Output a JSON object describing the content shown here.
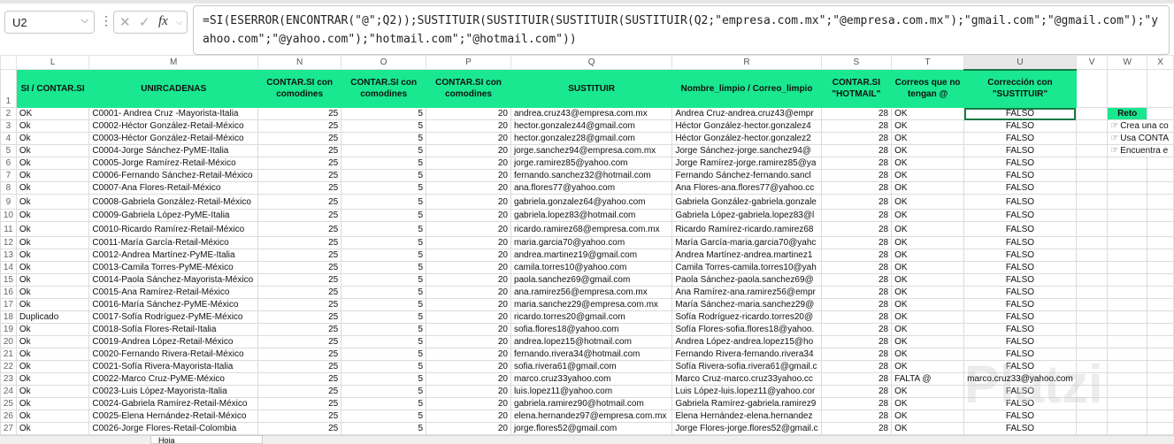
{
  "name_box": "U2",
  "formula": "=SI(ESERROR(ENCONTRAR(\"@\";Q2));SUSTITUIR(SUSTITUIR(SUSTITUIR(SUSTITUIR(Q2;\"empresa.com.mx\";\"@empresa.com.mx\");\"gmail.com\";\"@gmail.com\");\"yahoo.com\";\"@yahoo.com\");\"hotmail.com\";\"@hotmail.com\"))",
  "fx_label": "fx",
  "columns": [
    "L",
    "M",
    "N",
    "O",
    "P",
    "Q",
    "R",
    "S",
    "T",
    "U",
    "V",
    "W",
    "X"
  ],
  "headers": [
    "SI / CONTAR.SI",
    "UNIRCADENAS",
    "CONTAR.SI con comodines",
    "CONTAR.SI con comodines",
    "CONTAR.SI con comodines",
    "SUSTITUIR",
    "Nombre_limpio / Correo_limpio",
    "CONTAR.SI \"HOTMAIL\"",
    "Correos que no tengan @",
    "Corrección con \"SUSTITUIR\""
  ],
  "reto": {
    "title": "Reto",
    "items": [
      "Crea una co",
      "Usa CONTA",
      "Encuentra e"
    ]
  },
  "watermark": "Platzi",
  "sheet_tab": "Hoja",
  "rows": [
    {
      "n": 2,
      "L": "OK",
      "M": "C0001- Andrea Cruz  -Mayorista-Italia",
      "N": 25,
      "O": 5,
      "P": 20,
      "Q": "andrea.cruz43@empresa.com.mx",
      "R": "Andrea Cruz-andrea.cruz43@empr",
      "S": 28,
      "T": "OK",
      "U": "FALSO"
    },
    {
      "n": 3,
      "L": "Ok",
      "M": "C0002-Héctor González-Retail-México",
      "N": 25,
      "O": 5,
      "P": 20,
      "Q": "hector.gonzalez44@gmail.com",
      "R": "Héctor González-hector.gonzalez4",
      "S": 28,
      "T": "OK",
      "U": "FALSO"
    },
    {
      "n": 4,
      "L": "Ok",
      "M": "C0003-Héctor González-Retail-México",
      "N": 25,
      "O": 5,
      "P": 20,
      "Q": "hector.gonzalez28@gmail.com",
      "R": "Héctor González-hector.gonzalez2",
      "S": 28,
      "T": "OK",
      "U": "FALSO"
    },
    {
      "n": 5,
      "L": "Ok",
      "M": "C0004-Jorge Sánchez-PyME-Italia",
      "N": 25,
      "O": 5,
      "P": 20,
      "Q": "jorge.sanchez94@empresa.com.mx",
      "R": "Jorge Sánchez-jorge.sanchez94@",
      "S": 28,
      "T": "OK",
      "U": "FALSO"
    },
    {
      "n": 6,
      "L": "Ok",
      "M": "C0005-Jorge Ramírez-Retail-México",
      "N": 25,
      "O": 5,
      "P": 20,
      "Q": "jorge.ramirez85@yahoo.com",
      "R": "Jorge Ramírez-jorge.ramirez85@ya",
      "S": 28,
      "T": "OK",
      "U": "FALSO"
    },
    {
      "n": 7,
      "L": "Ok",
      "M": "C0006-Fernando Sánchez-Retail-México",
      "N": 25,
      "O": 5,
      "P": 20,
      "Q": "fernando.sanchez32@hotmail.com",
      "R": "Fernando Sánchez-fernando.sancl",
      "S": 28,
      "T": "OK",
      "U": "FALSO"
    },
    {
      "n": 8,
      "L": "Ok",
      "M": "C0007-Ana Flores-Retail-México",
      "N": 25,
      "O": 5,
      "P": 20,
      "Q": "ana.flores77@yahoo.com",
      "R": "Ana Flores-ana.flores77@yahoo.cc",
      "S": 28,
      "T": "OK",
      "U": "FALSO"
    },
    {
      "n": 9,
      "L": "Ok",
      "M": "C0008-Gabriela González-Retail-México",
      "N": 25,
      "O": 5,
      "P": 20,
      "Q": "gabriela.gonzalez64@yahoo.com",
      "R": "Gabriela González-gabriela.gonzale",
      "S": 28,
      "T": "OK",
      "U": "FALSO"
    },
    {
      "n": 10,
      "L": "Ok",
      "M": "C0009-Gabriela López-PyME-Italia",
      "N": 25,
      "O": 5,
      "P": 20,
      "Q": "gabriela.lopez83@hotmail.com",
      "R": "Gabriela López-gabriela.lopez83@l",
      "S": 28,
      "T": "OK",
      "U": "FALSO"
    },
    {
      "n": 11,
      "L": "Ok",
      "M": "C0010-Ricardo Ramírez-Retail-México",
      "N": 25,
      "O": 5,
      "P": 20,
      "Q": "ricardo.ramirez68@empresa.com.mx",
      "R": "Ricardo Ramírez-ricardo.ramirez68",
      "S": 28,
      "T": "OK",
      "U": "FALSO"
    },
    {
      "n": 12,
      "L": "Ok",
      "M": "C0011-María García-Retail-México",
      "N": 25,
      "O": 5,
      "P": 20,
      "Q": "maria.garcia70@yahoo.com",
      "R": "María García-maria.garcia70@yahc",
      "S": 28,
      "T": "OK",
      "U": "FALSO"
    },
    {
      "n": 13,
      "L": "Ok",
      "M": "C0012-Andrea Martínez-PyME-Italia",
      "N": 25,
      "O": 5,
      "P": 20,
      "Q": "andrea.martinez19@gmail.com",
      "R": "Andrea Martínez-andrea.martinez1",
      "S": 28,
      "T": "OK",
      "U": "FALSO"
    },
    {
      "n": 14,
      "L": "Ok",
      "M": "C0013-Camila Torres-PyME-México",
      "N": 25,
      "O": 5,
      "P": 20,
      "Q": "camila.torres10@yahoo.com",
      "R": "Camila Torres-camila.torres10@yah",
      "S": 28,
      "T": "OK",
      "U": "FALSO"
    },
    {
      "n": 15,
      "L": "Ok",
      "M": "C0014-Paola Sánchez-Mayorista-México",
      "N": 25,
      "O": 5,
      "P": 20,
      "Q": "paola.sanchez69@gmail.com",
      "R": "Paola Sánchez-paola.sanchez69@",
      "S": 28,
      "T": "OK",
      "U": "FALSO"
    },
    {
      "n": 16,
      "L": "Ok",
      "M": "C0015-Ana Ramírez-Retail-México",
      "N": 25,
      "O": 5,
      "P": 20,
      "Q": "ana.ramirez56@empresa.com.mx",
      "R": "Ana Ramírez-ana.ramirez56@empr",
      "S": 28,
      "T": "OK",
      "U": "FALSO"
    },
    {
      "n": 17,
      "L": "Ok",
      "M": "C0016-María Sánchez-PyME-México",
      "N": 25,
      "O": 5,
      "P": 20,
      "Q": "maria.sanchez29@empresa.com.mx",
      "R": "María Sánchez-maria.sanchez29@",
      "S": 28,
      "T": "OK",
      "U": "FALSO"
    },
    {
      "n": 18,
      "L": "Duplicado",
      "M": "C0017-Sofía Rodríguez-PyME-México",
      "N": 25,
      "O": 5,
      "P": 20,
      "Q": "ricardo.torres20@gmail.com",
      "R": "Sofía Rodríguez-ricardo.torres20@",
      "S": 28,
      "T": "OK",
      "U": "FALSO"
    },
    {
      "n": 19,
      "L": "Ok",
      "M": "C0018-Sofía Flores-Retail-Italia",
      "N": 25,
      "O": 5,
      "P": 20,
      "Q": "sofia.flores18@yahoo.com",
      "R": "Sofía Flores-sofia.flores18@yahoo.",
      "S": 28,
      "T": "OK",
      "U": "FALSO"
    },
    {
      "n": 20,
      "L": "Ok",
      "M": "C0019-Andrea López-Retail-México",
      "N": 25,
      "O": 5,
      "P": 20,
      "Q": "andrea.lopez15@hotmail.com",
      "R": "Andrea López-andrea.lopez15@ho",
      "S": 28,
      "T": "OK",
      "U": "FALSO"
    },
    {
      "n": 21,
      "L": "Ok",
      "M": "C0020-Fernando Rivera-Retail-México",
      "N": 25,
      "O": 5,
      "P": 20,
      "Q": "fernando.rivera34@hotmail.com",
      "R": "Fernando Rivera-fernando.rivera34",
      "S": 28,
      "T": "OK",
      "U": "FALSO"
    },
    {
      "n": 22,
      "L": "Ok",
      "M": "C0021-Sofía Rivera-Mayorista-Italia",
      "N": 25,
      "O": 5,
      "P": 20,
      "Q": "sofia.rivera61@gmail.com",
      "R": "Sofía Rivera-sofia.rivera61@gmail.c",
      "S": 28,
      "T": "OK",
      "U": "FALSO"
    },
    {
      "n": 23,
      "L": "Ok",
      "M": "C0022-Marco Cruz-PyME-México",
      "N": 25,
      "O": 5,
      "P": 20,
      "Q": "marco.cruz33yahoo.com",
      "R": "Marco Cruz-marco.cruz33yahoo.cc",
      "S": 28,
      "T": "FALTA @",
      "U": "marco.cruz33@yahoo.com"
    },
    {
      "n": 24,
      "L": "Ok",
      "M": "C0023-Luis López-Mayorista-Italia",
      "N": 25,
      "O": 5,
      "P": 20,
      "Q": "luis.lopez11@yahoo.com",
      "R": "Luis López-luis.lopez11@yahoo.cor",
      "S": 28,
      "T": "OK",
      "U": "FALSO"
    },
    {
      "n": 25,
      "L": "Ok",
      "M": "C0024-Gabriela Ramírez-Retail-México",
      "N": 25,
      "O": 5,
      "P": 20,
      "Q": "gabriela.ramirez90@hotmail.com",
      "R": "Gabriela Ramírez-gabriela.ramirez9",
      "S": 28,
      "T": "OK",
      "U": "FALSO"
    },
    {
      "n": 26,
      "L": "Ok",
      "M": "C0025-Elena Hernández-Retail-México",
      "N": 25,
      "O": 5,
      "P": 20,
      "Q": "elena.hernandez97@empresa.com.mx",
      "R": "Elena Hernández-elena.hernandez",
      "S": 28,
      "T": "OK",
      "U": "FALSO"
    },
    {
      "n": 27,
      "L": "Ok",
      "M": "C0026-Jorge Flores-Retail-Colombia",
      "N": 25,
      "O": 5,
      "P": 20,
      "Q": "jorge.flores52@gmail.com",
      "R": "Jorge Flores-jorge.flores52@gmail.c",
      "S": 28,
      "T": "OK",
      "U": "FALSO"
    }
  ]
}
